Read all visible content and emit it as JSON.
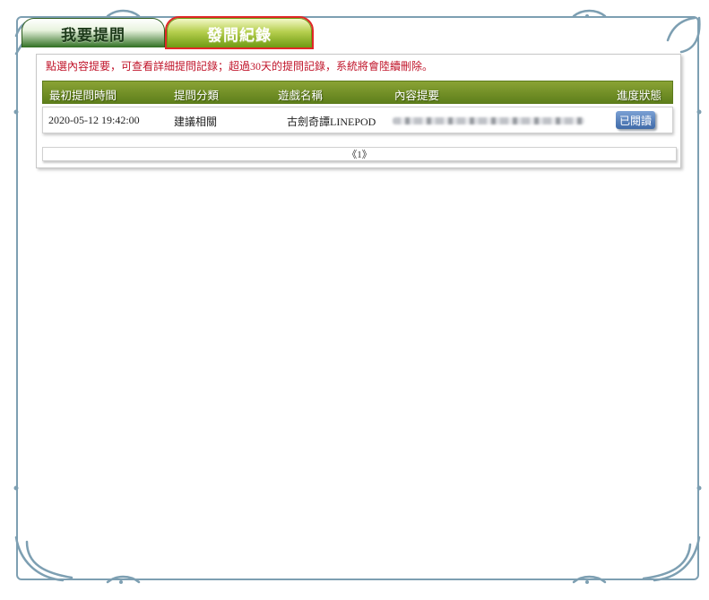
{
  "tabs": {
    "ask": "我要提問",
    "record": "發問紀錄"
  },
  "notice": "點選內容提要，可查看詳細提問記錄；超過30天的提問記錄，系統將會陸續刪除。",
  "table": {
    "headers": [
      "最初提問時間",
      "提問分類",
      "遊戲名稱",
      "內容提要",
      "進度狀態"
    ],
    "rows": [
      {
        "time": "2020-05-12 19:42:00",
        "category": "建議相關",
        "game": "古劍奇譚LINEPOD",
        "status": "已閱讀"
      }
    ]
  },
  "pager": "《1》",
  "colors": {
    "header_green": "#6b8a23",
    "tab_highlight": "#e02828",
    "notice_red": "#c0142a",
    "status_blue": "#4a74b0",
    "frame_blue": "#7d9fb2"
  }
}
